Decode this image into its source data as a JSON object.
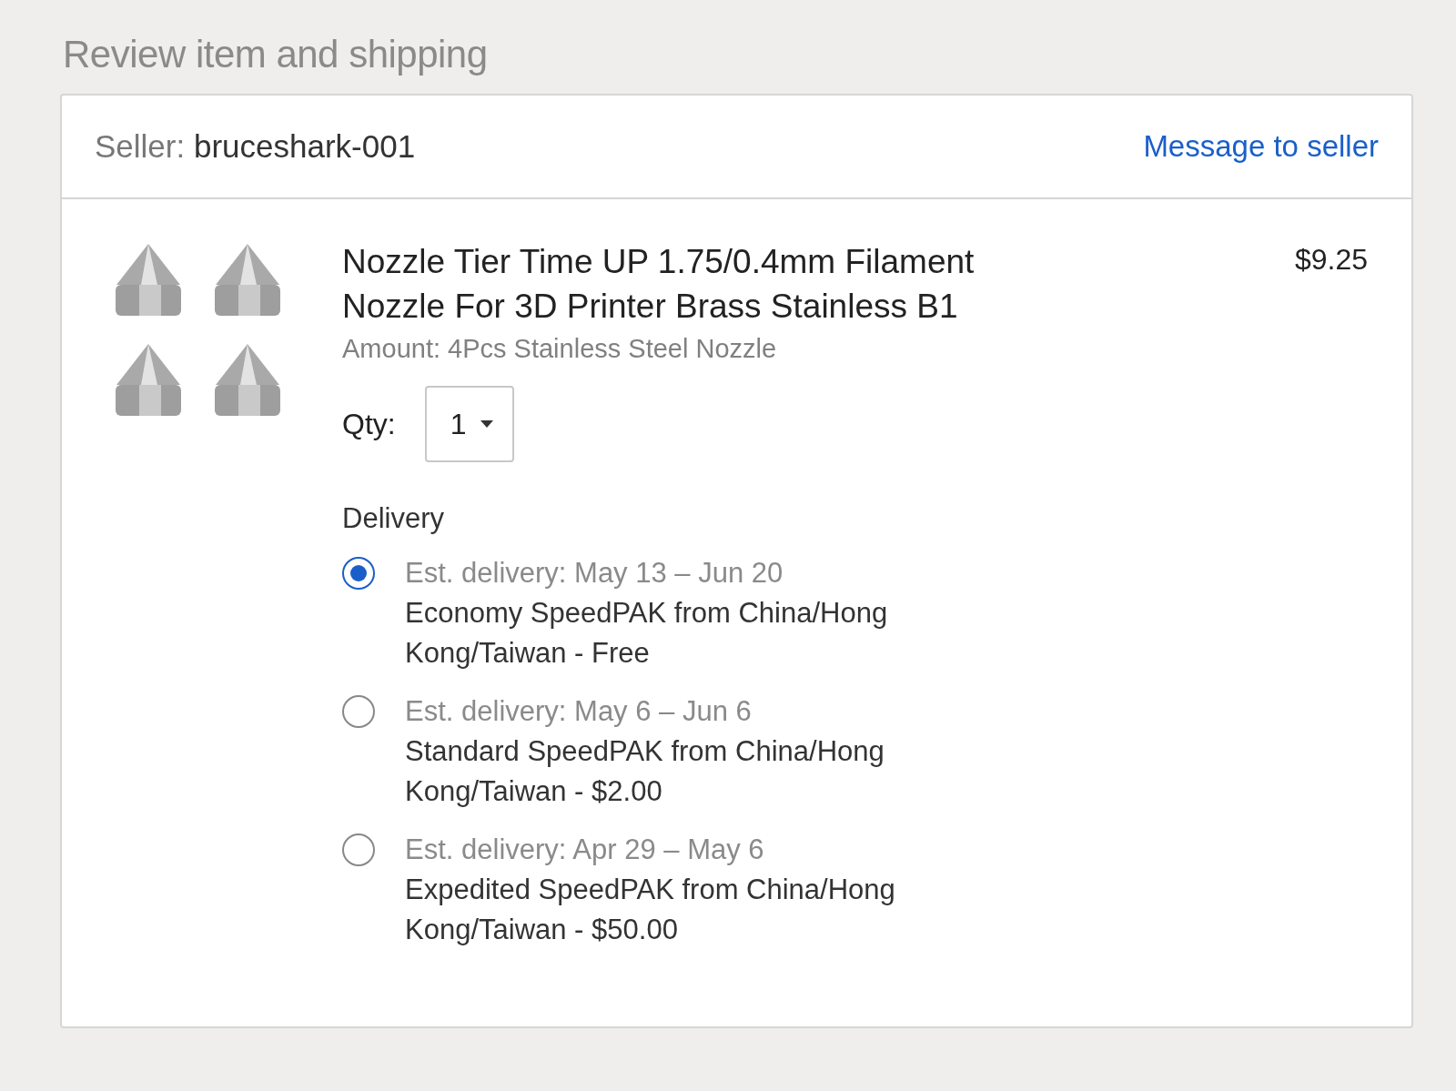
{
  "section_title": "Review item and shipping",
  "seller": {
    "label": "Seller:",
    "name": "bruceshark-001",
    "message_link": "Message to seller"
  },
  "item": {
    "title": "Nozzle Tier Time UP 1.75/0.4mm Filament Nozzle For 3D Printer Brass Stainless B1",
    "price": "$9.25",
    "amount": "Amount: 4Pcs Stainless Steel Nozzle",
    "qty_label": "Qty:",
    "qty_value": "1"
  },
  "delivery": {
    "heading": "Delivery",
    "options": [
      {
        "estimate": "Est. delivery: May 13 – Jun 20",
        "service": "Economy SpeedPAK from China/Hong Kong/Taiwan - Free",
        "selected": true
      },
      {
        "estimate": "Est. delivery: May 6 – Jun 6",
        "service": "Standard SpeedPAK from China/Hong Kong/Taiwan - $2.00",
        "selected": false
      },
      {
        "estimate": "Est. delivery: Apr 29 – May 6",
        "service": "Expedited SpeedPAK from China/Hong Kong/Taiwan - $50.00",
        "selected": false
      }
    ]
  }
}
